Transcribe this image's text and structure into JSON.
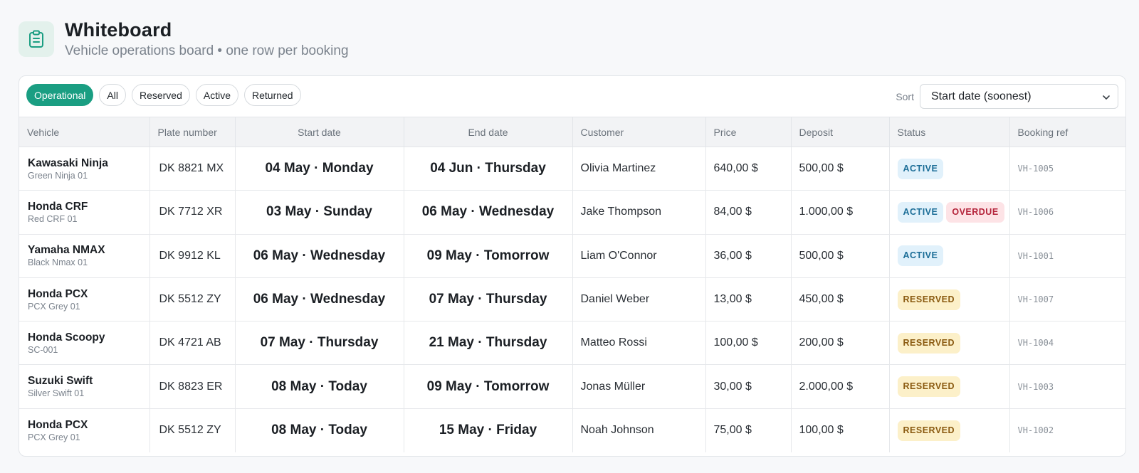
{
  "header": {
    "icon": "clipboard-icon",
    "title": "Whiteboard",
    "subtitle": "Vehicle operations board • one row per booking"
  },
  "filters": [
    {
      "label": "Operational",
      "active": true
    },
    {
      "label": "All",
      "active": false
    },
    {
      "label": "Reserved",
      "active": false
    },
    {
      "label": "Active",
      "active": false
    },
    {
      "label": "Returned",
      "active": false
    }
  ],
  "sort": {
    "label": "Sort",
    "value": "Start date (soonest)",
    "icon": "chevron-down-icon"
  },
  "columns": [
    "Vehicle",
    "Plate number",
    "Start date",
    "End date",
    "Customer",
    "Price",
    "Deposit",
    "Status",
    "Booking ref"
  ],
  "colors": {
    "accent": "#1a9e82",
    "active_badge": "#1b6d97",
    "overdue_badge": "#b4233a",
    "reserved_badge": "#8a5a10"
  },
  "rows": [
    {
      "vehicle": "Kawasaki Ninja",
      "sub": "Green Ninja 01",
      "plate": "DK 8821 MX",
      "start": "04 May · Monday",
      "end": "04 Jun · Thursday",
      "customer": "Olivia Martinez",
      "price": "640,00 $",
      "deposit": "500,00 $",
      "statuses": [
        {
          "label": "ACTIVE",
          "kind": "active"
        }
      ],
      "ref": "VH-1005"
    },
    {
      "vehicle": "Honda CRF",
      "sub": "Red CRF 01",
      "plate": "DK 7712 XR",
      "start": "03 May · Sunday",
      "end": "06 May · Wednesday",
      "customer": "Jake Thompson",
      "price": "84,00 $",
      "deposit": "1.000,00 $",
      "statuses": [
        {
          "label": "ACTIVE",
          "kind": "active"
        },
        {
          "label": "OVERDUE",
          "kind": "overdue"
        }
      ],
      "ref": "VH-1006"
    },
    {
      "vehicle": "Yamaha NMAX",
      "sub": "Black Nmax 01",
      "plate": "DK 9912 KL",
      "start": "06 May · Wednesday",
      "end": "09 May · Tomorrow",
      "customer": "Liam O'Connor",
      "price": "36,00 $",
      "deposit": "500,00 $",
      "statuses": [
        {
          "label": "ACTIVE",
          "kind": "active"
        }
      ],
      "ref": "VH-1001"
    },
    {
      "vehicle": "Honda PCX",
      "sub": "PCX Grey 01",
      "plate": "DK 5512 ZY",
      "start": "06 May · Wednesday",
      "end": "07 May · Thursday",
      "customer": "Daniel Weber",
      "price": "13,00 $",
      "deposit": "450,00 $",
      "statuses": [
        {
          "label": "RESERVED",
          "kind": "reserved"
        }
      ],
      "ref": "VH-1007"
    },
    {
      "vehicle": "Honda Scoopy",
      "sub": "SC-001",
      "plate": "DK 4721 AB",
      "start": "07 May · Thursday",
      "end": "21 May · Thursday",
      "customer": "Matteo Rossi",
      "price": "100,00 $",
      "deposit": "200,00 $",
      "statuses": [
        {
          "label": "RESERVED",
          "kind": "reserved"
        }
      ],
      "ref": "VH-1004"
    },
    {
      "vehicle": "Suzuki Swift",
      "sub": "Silver Swift 01",
      "plate": "DK 8823 ER",
      "start": "08 May · Today",
      "end": "09 May · Tomorrow",
      "customer": "Jonas Müller",
      "price": "30,00 $",
      "deposit": "2.000,00 $",
      "statuses": [
        {
          "label": "RESERVED",
          "kind": "reserved"
        }
      ],
      "ref": "VH-1003"
    },
    {
      "vehicle": "Honda PCX",
      "sub": "PCX Grey 01",
      "plate": "DK 5512 ZY",
      "start": "08 May · Today",
      "end": "15 May · Friday",
      "customer": "Noah Johnson",
      "price": "75,00 $",
      "deposit": "100,00 $",
      "statuses": [
        {
          "label": "RESERVED",
          "kind": "reserved"
        }
      ],
      "ref": "VH-1002"
    }
  ]
}
